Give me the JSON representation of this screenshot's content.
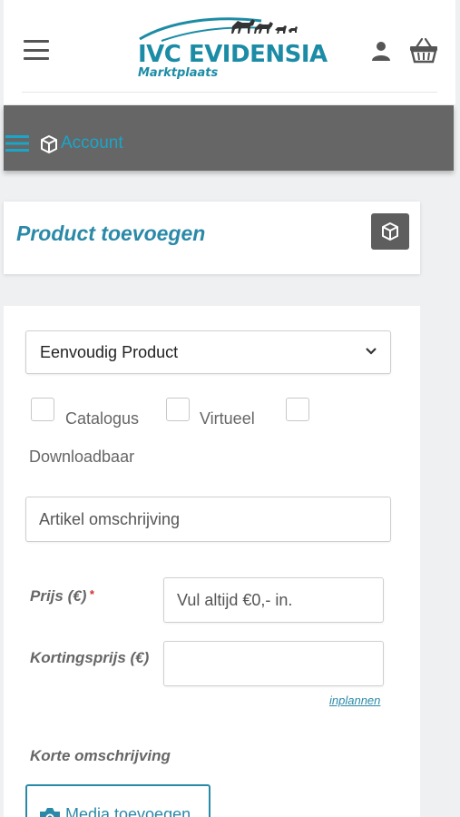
{
  "header": {
    "logo_title": "IVC EVIDENSIA",
    "logo_subtitle": "Marktplaats",
    "icons": [
      "hamburger-icon",
      "user-icon",
      "basket-icon"
    ]
  },
  "account_bar": {
    "label": "Account",
    "icons": [
      "hamburger-icon",
      "cube-icon"
    ]
  },
  "product_card": {
    "title": "Product toevoegen",
    "icon": "cube-icon"
  },
  "form": {
    "product_type": {
      "selected": "Eenvoudig Product"
    },
    "checkboxes": [
      {
        "label": "Catalogus",
        "checked": false
      },
      {
        "label": "Virtueel",
        "checked": false
      },
      {
        "label": "Downloadbaar",
        "checked": false
      }
    ],
    "title_field": {
      "placeholder": "Artikel omschrijving"
    },
    "price": {
      "label": "Prijs (€)",
      "required_mark": "*",
      "placeholder": "Vul altijd €0,- in."
    },
    "sale_price": {
      "label": "Kortingsprijs (€)",
      "placeholder": ""
    },
    "schedule_link": "inplannen",
    "short_description": {
      "label": "Korte omschrijving"
    },
    "media_button": {
      "label": "Media toevoegen",
      "icon": "camera-icon"
    }
  },
  "colors": {
    "brand": "#1c8ca6",
    "link": "#2a89a8",
    "account_bar_bg": "#666666",
    "required": "#d0302f"
  }
}
